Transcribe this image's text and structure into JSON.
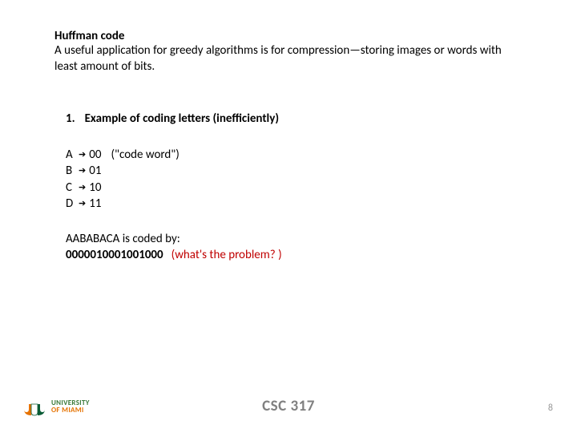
{
  "header": {
    "title": "Huffman code",
    "intro": "A useful application for greedy algorithms is for compression—storing images or words with least amount of bits."
  },
  "section": {
    "number": "1.",
    "heading": "Example of coding letters (inefficiently)"
  },
  "codes": [
    {
      "letter": "A",
      "bits": "00",
      "note": "(\"code word\")"
    },
    {
      "letter": "B",
      "bits": "01",
      "note": ""
    },
    {
      "letter": "C",
      "bits": "10",
      "note": ""
    },
    {
      "letter": "D",
      "bits": "11",
      "note": ""
    }
  ],
  "encoded": {
    "label": "AABABACA is coded by:",
    "bitstring": "0000010001001000",
    "question": "(what's the problem? )"
  },
  "footer": {
    "course": "CSC 317",
    "page": "8",
    "logo_line1": "UNIVERSITY",
    "logo_line2": "OF MIAMI"
  }
}
